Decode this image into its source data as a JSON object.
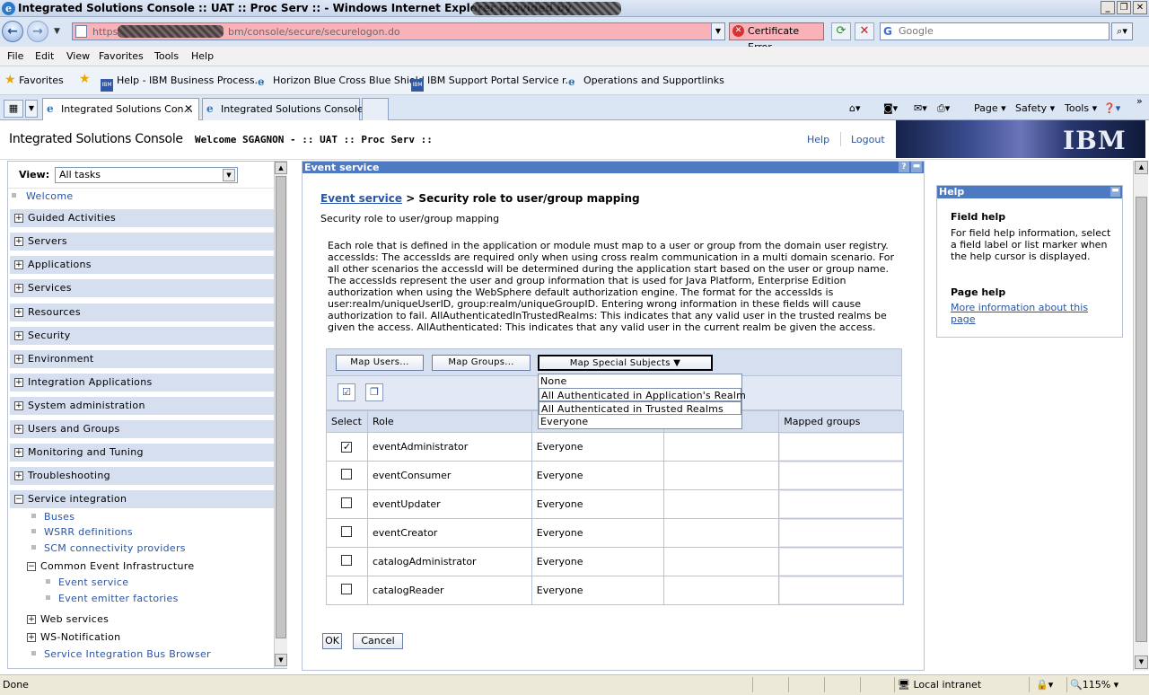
{
  "window": {
    "title": "Integrated Solutions Console  :: UAT :: Proc Serv :: - Windows Internet Explorer provided by"
  },
  "address_bar": {
    "url_prefix": "https",
    "url_suffix": "bm/console/secure/securelogon.do",
    "certificate_error": "Certificate Error"
  },
  "search": {
    "placeholder": "Google"
  },
  "menu": [
    "File",
    "Edit",
    "View",
    "Favorites",
    "Tools",
    "Help"
  ],
  "favorites": {
    "label": "Favorites",
    "items": [
      "Help - IBM Business Process...",
      "Horizon Blue Cross Blue Shield",
      "IBM Support Portal Service r...",
      "Operations and Supportlinks"
    ]
  },
  "tabs": [
    {
      "label": "Integrated Solutions Con..."
    },
    {
      "label": "Integrated Solutions Console"
    }
  ],
  "command_bar": {
    "page": "Page",
    "safety": "Safety",
    "tools": "Tools"
  },
  "console_header": {
    "product": "Integrated Solutions Console",
    "welcome": "Welcome SGAGNON - :: UAT :: Proc Serv ::",
    "help": "Help",
    "logout": "Logout",
    "brand": "IBM"
  },
  "nav": {
    "view_label": "View:",
    "view_value": "All tasks",
    "welcome": "Welcome",
    "sections": [
      "Guided Activities",
      "Servers",
      "Applications",
      "Services",
      "Resources",
      "Security",
      "Environment",
      "Integration Applications",
      "System administration",
      "Users and Groups",
      "Monitoring and Tuning",
      "Troubleshooting",
      "Service integration"
    ],
    "service_integration": {
      "buses": "Buses",
      "wsrr": "WSRR definitions",
      "scm": "SCM connectivity providers",
      "cei": "Common Event Infrastructure",
      "event_service": "Event service",
      "event_emitter": "Event emitter factories",
      "web_services": "Web services",
      "ws_notification": "WS-Notification",
      "sib_browser": "Service Integration Bus Browser"
    }
  },
  "panel": {
    "title": "Event service",
    "breadcrumb_link": "Event service",
    "breadcrumb_rest": " > Security role to user/group mapping",
    "subtitle": "Security role to user/group mapping",
    "description": "Each role that is defined in the application or module must map to a user or group from the domain user registry. accessIds: The accessIds are required only when using cross realm communication in a multi domain scenario. For all other scenarios the accessId will be determined during the application start based on the user or group name. The accessIds represent the user and group information that is used for Java Platform, Enterprise Edition authorization when using the WebSphere default authorization engine. The format for the accessIds is user:realm/uniqueUserID, group:realm/uniqueGroupID. Entering wrong information in these fields will cause authorization to fail. AllAuthenticatedInTrustedRealms: This indicates that any valid user in the trusted realms be given the access. AllAuthenticated: This indicates that any valid user in the current realm be given the access.",
    "buttons": {
      "map_users": "Map Users...",
      "map_groups": "Map Groups...",
      "map_special": "Map Special Subjects"
    },
    "special_subjects_options": [
      "None",
      "All Authenticated in Application's Realm",
      "All Authenticated in Trusted Realms",
      "Everyone"
    ],
    "table": {
      "headers": [
        "Select",
        "Role",
        "",
        "",
        "Mapped groups"
      ],
      "rows": [
        {
          "checked": true,
          "role": "eventAdministrator",
          "special": "Everyone"
        },
        {
          "checked": false,
          "role": "eventConsumer",
          "special": "Everyone"
        },
        {
          "checked": false,
          "role": "eventUpdater",
          "special": "Everyone"
        },
        {
          "checked": false,
          "role": "eventCreator",
          "special": "Everyone"
        },
        {
          "checked": false,
          "role": "catalogAdministrator",
          "special": "Everyone"
        },
        {
          "checked": false,
          "role": "catalogReader",
          "special": "Everyone"
        }
      ]
    },
    "ok": "OK",
    "cancel": "Cancel"
  },
  "help_panel": {
    "title": "Help",
    "field_help_title": "Field help",
    "field_help_text": "For field help information, select a field label or list marker when the help cursor is displayed.",
    "page_help_title": "Page help",
    "page_help_link": "More information about this page"
  },
  "status_bar": {
    "status": "Done",
    "zone": "Local intranet",
    "zoom": "115%"
  }
}
